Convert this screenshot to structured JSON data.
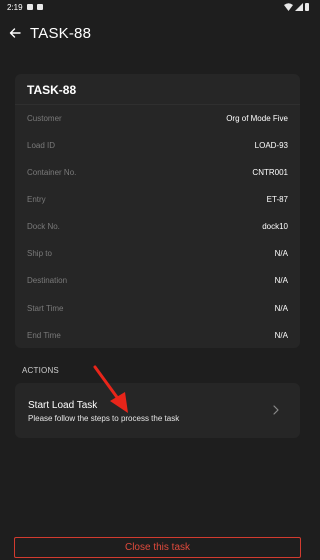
{
  "status_bar": {
    "time": "2:19"
  },
  "header": {
    "title": "TASK-88"
  },
  "card": {
    "title": "TASK-88",
    "rows": [
      {
        "label": "Customer",
        "value": "Org of Mode Five"
      },
      {
        "label": "Load ID",
        "value": "LOAD-93"
      },
      {
        "label": "Container No.",
        "value": "CNTR001"
      },
      {
        "label": "Entry",
        "value": "ET-87"
      },
      {
        "label": "Dock No.",
        "value": "dock10"
      },
      {
        "label": "Ship to",
        "value": "N/A"
      },
      {
        "label": "Destination",
        "value": "N/A"
      },
      {
        "label": "Start Time",
        "value": "N/A"
      },
      {
        "label": "End Time",
        "value": "N/A"
      }
    ]
  },
  "actions": {
    "label": "ACTIONS",
    "item": {
      "title": "Start Load Task",
      "subtitle": "Please follow the steps to process the task"
    }
  },
  "footer": {
    "close_label": "Close this task"
  },
  "colors": {
    "background": "#1e1e1e",
    "card": "#262626",
    "danger": "#d23b2f",
    "annotation_arrow": "#e8251a"
  }
}
